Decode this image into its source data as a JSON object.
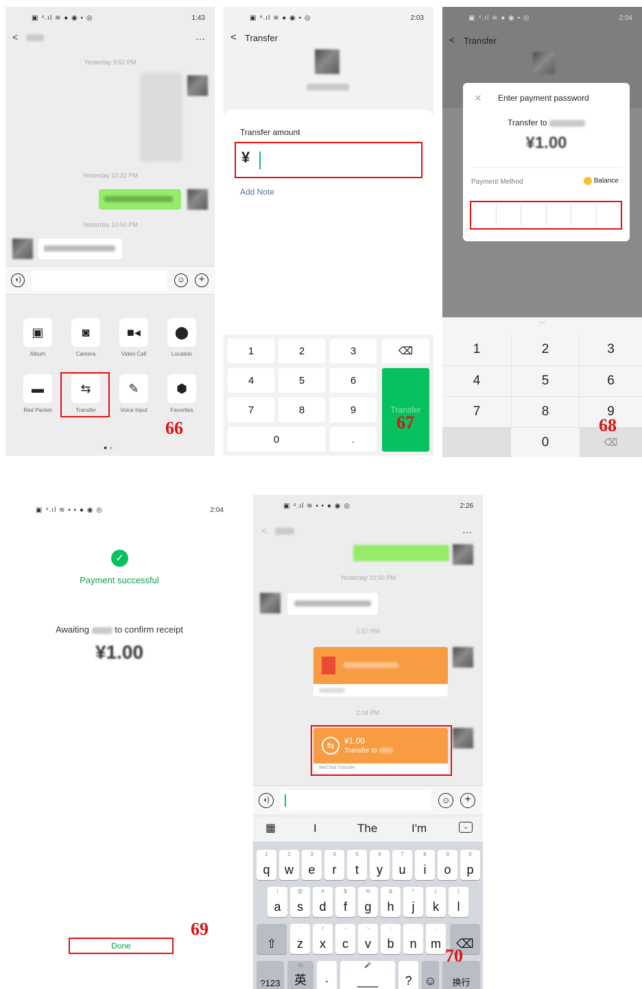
{
  "panel1": {
    "status_time": "1:43",
    "more": "···",
    "timestamps": [
      "Yesterday 9:52 PM",
      "Yesterday 10:22 PM",
      "Yesterday 10:50 PM"
    ],
    "grid": [
      {
        "label": "Album",
        "icon": "image-icon"
      },
      {
        "label": "Camera",
        "icon": "camera-icon"
      },
      {
        "label": "Video Call",
        "icon": "video-icon"
      },
      {
        "label": "Location",
        "icon": "location-icon"
      },
      {
        "label": "Red Packet",
        "icon": "red-packet-icon"
      },
      {
        "label": "Transfer",
        "icon": "transfer-icon"
      },
      {
        "label": "Voice Input",
        "icon": "microphone-icon"
      },
      {
        "label": "Favorites",
        "icon": "cube-icon"
      }
    ],
    "step": "66"
  },
  "panel2": {
    "status_time": "2:03",
    "title": "Transfer",
    "amount_label": "Transfer amount",
    "currency": "¥",
    "add_note": "Add Note",
    "keys": [
      "1",
      "2",
      "3",
      "4",
      "5",
      "6",
      "7",
      "8",
      "9",
      "0",
      "."
    ],
    "transfer_button": "Transfer",
    "step": "67"
  },
  "panel3": {
    "status_time": "2:04",
    "title": "Transfer",
    "dialog_title": "Enter payment password",
    "transfer_to": "Transfer to",
    "amount": "¥1.00",
    "payment_method_label": "Payment Method",
    "payment_method_value": "Balance",
    "keys": [
      "1",
      "2",
      "3",
      "4",
      "5",
      "6",
      "7",
      "8",
      "9",
      "0"
    ],
    "step": "68"
  },
  "panel4": {
    "status_time": "2:04",
    "success_text": "Payment successful",
    "awaiting_prefix": "Awaiting",
    "awaiting_suffix": "to confirm receipt",
    "amount": "¥1.00",
    "done_button": "Done",
    "step": "69"
  },
  "panel5": {
    "status_time": "2:26",
    "more": "···",
    "timestamps": [
      "Yesterday 10:50 PM",
      "1:57 PM",
      "2:04 PM"
    ],
    "transfer_amount": "¥1.00",
    "transfer_to": "Transfer to",
    "transfer_footer": "WeChat Transfer",
    "suggestions": [
      "I",
      "The",
      "I'm"
    ],
    "row1": [
      [
        "1",
        "q"
      ],
      [
        "2",
        "w"
      ],
      [
        "3",
        "e"
      ],
      [
        "4",
        "r"
      ],
      [
        "5",
        "t"
      ],
      [
        "6",
        "y"
      ],
      [
        "7",
        "u"
      ],
      [
        "8",
        "i"
      ],
      [
        "9",
        "o"
      ],
      [
        "0",
        "p"
      ]
    ],
    "row2": [
      [
        "!",
        "a"
      ],
      [
        "@",
        "s"
      ],
      [
        "#",
        "d"
      ],
      [
        "$",
        "f"
      ],
      [
        "%",
        "g"
      ],
      [
        "&",
        "h"
      ],
      [
        "*",
        "j"
      ],
      [
        "(",
        "k"
      ],
      [
        ")",
        "l"
      ]
    ],
    "row3": [
      [
        "'",
        "z"
      ],
      [
        "/",
        "x"
      ],
      [
        "-",
        "c"
      ],
      [
        "~",
        "v"
      ],
      [
        ";",
        "b"
      ],
      [
        ":",
        "n"
      ],
      [
        ",",
        "m"
      ]
    ],
    "key_123": "?123",
    "key_lang": "英",
    "key_lang_sub": "中",
    "key_dot": "·",
    "key_question": "?",
    "key_enter": "换行",
    "step": "70"
  },
  "colors": {
    "wechat_green": "#07c160",
    "annotation_red": "#e01010",
    "transfer_orange": "#f79c42"
  }
}
